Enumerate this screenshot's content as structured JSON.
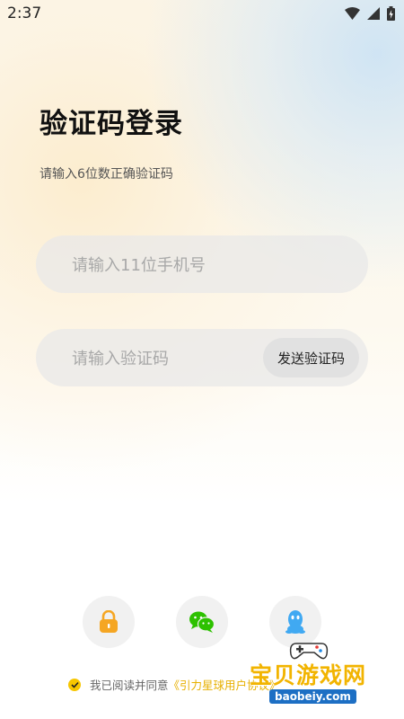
{
  "status_bar": {
    "time": "2:37"
  },
  "login": {
    "title": "验证码登录",
    "subtitle": "请输入6位数正确验证码",
    "phone_placeholder": "请输入11位手机号",
    "code_placeholder": "请输入验证码",
    "send_code_label": "发送验证码"
  },
  "alt_login": {
    "lock_color": "#f5a623",
    "wechat_color": "#2dc100",
    "qq_color": "#40a9f2"
  },
  "agreement": {
    "text": "我已阅读并同意",
    "link": "《引力星球用户协议》",
    "accent_color": "#f7c600"
  },
  "watermark": {
    "title": "宝贝游戏网",
    "url": "baobeiy.com"
  }
}
